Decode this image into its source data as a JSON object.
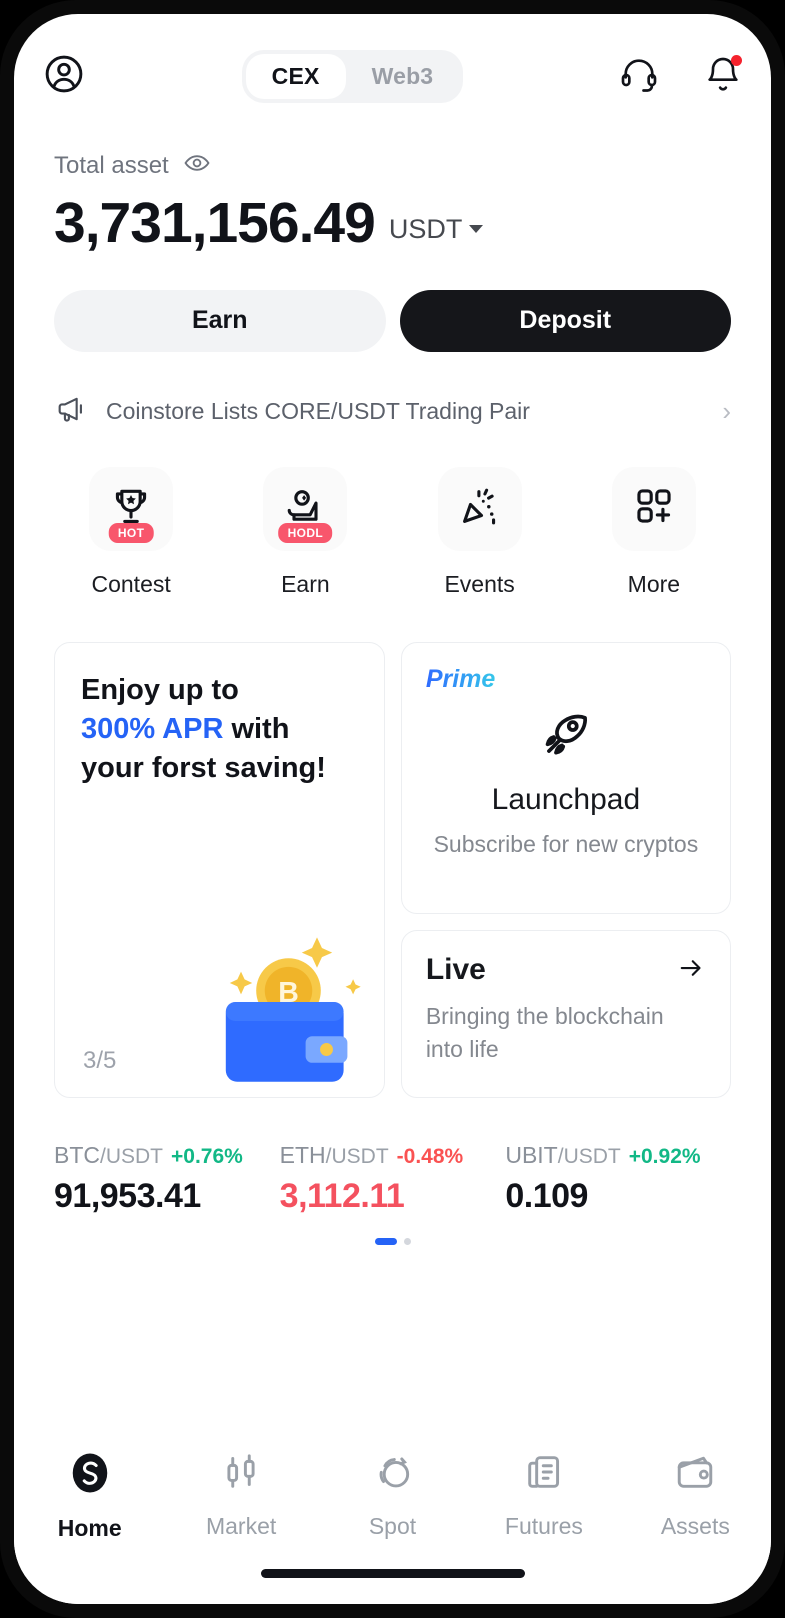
{
  "header": {
    "profile_icon": "user-circle-icon",
    "segments": [
      {
        "label": "CEX",
        "active": true
      },
      {
        "label": "Web3",
        "active": false
      }
    ],
    "support_icon": "headset-icon",
    "notification_icon": "bell-icon",
    "has_notification": true
  },
  "asset": {
    "label": "Total asset",
    "eye_icon": "eye-icon",
    "value": "3,731,156.49",
    "currency": "USDT"
  },
  "actions": {
    "earn_label": "Earn",
    "deposit_label": "Deposit"
  },
  "announcement": {
    "icon": "megaphone-icon",
    "text": "Coinstore Lists CORE/USDT Trading Pair",
    "chevron": "chevron-right-icon"
  },
  "quick_actions": [
    {
      "label": "Contest",
      "icon": "trophy-icon",
      "badge": "HOT"
    },
    {
      "label": "Earn",
      "icon": "hand-coin-icon",
      "badge": "HODL"
    },
    {
      "label": "Events",
      "icon": "party-popper-icon",
      "badge": ""
    },
    {
      "label": "More",
      "icon": "grid-plus-icon",
      "badge": ""
    }
  ],
  "promo_card": {
    "line1": "Enjoy up to",
    "accent": "300% APR",
    "line2_rest": " with",
    "line3": "your forst saving!",
    "index_current": "3",
    "index_total": "/5",
    "art": "wallet-bitcoin-illustration"
  },
  "launchpad_card": {
    "tag": "Prime",
    "icon": "rocket-icon",
    "title": "Launchpad",
    "subtitle": "Subscribe for new cryptos"
  },
  "live_card": {
    "title": "Live",
    "arrow_icon": "arrow-right-icon",
    "subtitle": "Bringing the blockchain into life"
  },
  "tickers": [
    {
      "base": "BTC",
      "quote": "/USDT",
      "change": "+0.76%",
      "direction": "up",
      "price": "91,953.41"
    },
    {
      "base": "ETH",
      "quote": "/USDT",
      "change": "-0.48%",
      "direction": "down",
      "price": "3,112.11"
    },
    {
      "base": "UBIT",
      "quote": "/USDT",
      "change": "+0.92%",
      "direction": "up",
      "price": "0.109"
    }
  ],
  "carousel": {
    "total": 2,
    "active_index": 0
  },
  "bottom_nav": [
    {
      "label": "Home",
      "icon": "coinstore-logo-icon",
      "active": true
    },
    {
      "label": "Market",
      "icon": "candlestick-icon",
      "active": false
    },
    {
      "label": "Spot",
      "icon": "swap-circles-icon",
      "active": false
    },
    {
      "label": "Futures",
      "icon": "contract-document-icon",
      "active": false
    },
    {
      "label": "Assets",
      "icon": "wallet-icon",
      "active": false
    }
  ],
  "colors": {
    "accent_blue": "#2563f6",
    "up_green": "#12b886",
    "down_red": "#fa5252",
    "badge_red": "#f8566c",
    "dark": "#15161a"
  }
}
